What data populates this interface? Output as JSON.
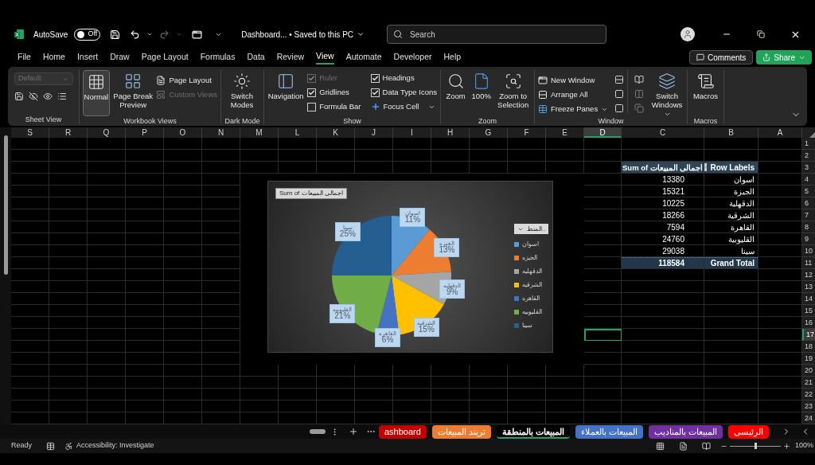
{
  "title_bar": {
    "autosave_label": "AutoSave",
    "autosave": {
      "on": false,
      "label": "Off"
    },
    "file_name": "Dashboard...",
    "save_status": "• Saved to this PC",
    "search": {
      "placeholder": "Search"
    }
  },
  "menu_tabs": [
    {
      "label": "File",
      "selected": false
    },
    {
      "label": "Home",
      "selected": false
    },
    {
      "label": "Insert",
      "selected": false
    },
    {
      "label": "Draw",
      "selected": false
    },
    {
      "label": "Page Layout",
      "selected": false
    },
    {
      "label": "Formulas",
      "selected": false
    },
    {
      "label": "Data",
      "selected": false
    },
    {
      "label": "Review",
      "selected": false
    },
    {
      "label": "View",
      "selected": true
    },
    {
      "label": "Automate",
      "selected": false
    },
    {
      "label": "Developer",
      "selected": false
    },
    {
      "label": "Help",
      "selected": false
    }
  ],
  "comments_button": "Comments",
  "share_button": "Share",
  "ribbon": {
    "sheet_view": {
      "label": "Sheet View",
      "view_select": {
        "value": "Default",
        "disabled": true
      }
    },
    "workbook_views": {
      "label": "Workbook Views",
      "normal": {
        "label": "Normal",
        "selected": true
      },
      "page_break_preview": {
        "label": "Page Break Preview",
        "selected": false
      },
      "page_layout": "Page Layout",
      "custom_views": {
        "label": "Custom Views",
        "disabled": true
      }
    },
    "dark_mode": {
      "label": "Dark Mode",
      "switch_modes": "Switch Modes"
    },
    "show": {
      "label": "Show",
      "navigation": "Navigation",
      "options": [
        {
          "label": "Ruler",
          "checked": true,
          "disabled": true
        },
        {
          "label": "Gridlines",
          "checked": true,
          "disabled": false
        },
        {
          "label": "Formula Bar",
          "checked": false,
          "disabled": false
        },
        {
          "label": "Headings",
          "checked": true,
          "disabled": false
        },
        {
          "label": "Data Type Icons",
          "checked": true,
          "disabled": false
        }
      ],
      "focus_cell": "Focus Cell"
    },
    "zoom": {
      "label": "Zoom",
      "zoom": "Zoom",
      "hundred": "100%",
      "zoom_to_selection": "Zoom to Selection"
    },
    "window": {
      "label": "Window",
      "new_window": "New Window",
      "arrange_all": "Arrange All",
      "freeze_panes": "Freeze Panes",
      "switch_windows": "Switch Windows"
    },
    "macros": {
      "label": "Macros",
      "button": "Macros"
    }
  },
  "columns": [
    {
      "label": "S",
      "selected": false
    },
    {
      "label": "R",
      "selected": false
    },
    {
      "label": "Q",
      "selected": false
    },
    {
      "label": "P",
      "selected": false
    },
    {
      "label": "O",
      "selected": false
    },
    {
      "label": "N",
      "selected": false
    },
    {
      "label": "M",
      "selected": false
    },
    {
      "label": "L",
      "selected": false
    },
    {
      "label": "K",
      "selected": false
    },
    {
      "label": "J",
      "selected": false
    },
    {
      "label": "I",
      "selected": false
    },
    {
      "label": "H",
      "selected": false
    },
    {
      "label": "G",
      "selected": false
    },
    {
      "label": "F",
      "selected": false
    },
    {
      "label": "E",
      "selected": false
    },
    {
      "label": "D",
      "selected": true
    },
    {
      "label": "C",
      "selected": false
    },
    {
      "label": "B",
      "selected": false
    },
    {
      "label": "A",
      "selected": false
    }
  ],
  "rows": [
    {
      "label": "1",
      "selected": false
    },
    {
      "label": "2",
      "selected": false
    },
    {
      "label": "3",
      "selected": false
    },
    {
      "label": "4",
      "selected": false
    },
    {
      "label": "5",
      "selected": false
    },
    {
      "label": "6",
      "selected": false
    },
    {
      "label": "7",
      "selected": false
    },
    {
      "label": "8",
      "selected": false
    },
    {
      "label": "9",
      "selected": false
    },
    {
      "label": "10",
      "selected": false
    },
    {
      "label": "11",
      "selected": false
    },
    {
      "label": "12",
      "selected": false
    },
    {
      "label": "13",
      "selected": false
    },
    {
      "label": "14",
      "selected": false
    },
    {
      "label": "15",
      "selected": false
    },
    {
      "label": "16",
      "selected": false
    },
    {
      "label": "17",
      "selected": true
    },
    {
      "label": "18",
      "selected": false
    },
    {
      "label": "19",
      "selected": false
    },
    {
      "label": "20",
      "selected": false
    },
    {
      "label": "21",
      "selected": false
    },
    {
      "label": "22",
      "selected": false
    },
    {
      "label": "23",
      "selected": false
    },
    {
      "label": "24",
      "selected": false
    }
  ],
  "pivot": {
    "header": [
      "Sum of اجمالى المبيعات",
      "Row Labels"
    ],
    "rows": [
      [
        "13380",
        "اسوان"
      ],
      [
        "15321",
        "الجيزة"
      ],
      [
        "10225",
        "الدقهلية"
      ],
      [
        "18266",
        "الشرقية"
      ],
      [
        "7594",
        "القاهرة"
      ],
      [
        "24760",
        "القليوبية"
      ],
      [
        "29038",
        "سينا"
      ]
    ],
    "total": [
      "118584",
      "Grand Total"
    ]
  },
  "chart": {
    "legend_title": "المنط..",
    "legend_items": [
      "اسوان",
      "الجيزه",
      "الدقهليه",
      "الشرقيه",
      "القاهره",
      "القليوبيه",
      "سينا"
    ],
    "chart_data": {
      "type": "pie",
      "title": "Sum of اجمالى المبيعات",
      "legend": "right",
      "categories": [
        "اسوان",
        "الجيزه",
        "الدقهليه",
        "الشرقيه",
        "القاهره",
        "القليوبيه",
        "سينا"
      ],
      "series": [
        {
          "values": [
            11,
            13,
            9,
            15,
            6,
            21,
            25
          ]
        }
      ],
      "colors": [
        "#5b9bd5",
        "#ed7d31",
        "#a5a5a5",
        "#ffc000",
        "#4472c4",
        "#70ad47",
        "#255e91"
      ],
      "data_labels": "value_labels",
      "value_labels": [
        "11%",
        "13%",
        "9%",
        "15%",
        "6%",
        "21%",
        "25%"
      ]
    }
  },
  "sheet_tabs": [
    {
      "label": "الرئيسى",
      "color": "#ff0000",
      "selected": false
    },
    {
      "label": "المبيعات بالمناديب",
      "color": "#7030a0",
      "selected": false
    },
    {
      "label": "المبيعات بالعملاء",
      "color": "#4472c4",
      "selected": false
    },
    {
      "label": "المبيعات بالمنطقة",
      "color": "#000000",
      "selected": true
    },
    {
      "label": "تريند المبيعات",
      "color": "#ed7d31",
      "selected": false
    },
    {
      "label": "ashboard",
      "color": "#c00000",
      "selected": false
    }
  ],
  "status_bar": {
    "ready": "Ready",
    "accessibility": "Accessibility: Investigate",
    "zoom": "100%",
    "zoom_slider": {
      "level": 0.5
    }
  }
}
